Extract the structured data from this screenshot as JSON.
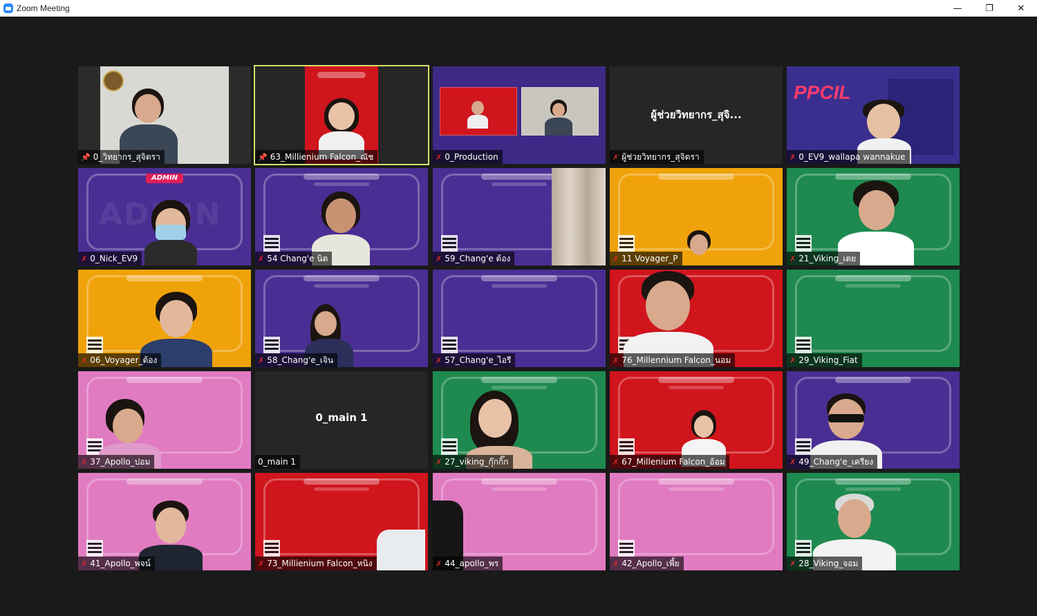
{
  "window": {
    "title": "Zoom Meeting",
    "minimize_glyph": "—",
    "restore_glyph": "❐",
    "close_glyph": "✕"
  },
  "icons": {
    "muted": "✗",
    "pinned": "📌"
  },
  "tiles": [
    {
      "name": "0_วิทยากร_สุจิตรา",
      "status": "pinned",
      "active": false
    },
    {
      "name": "63_Millienium Falcon_ณัช",
      "status": "pinned",
      "active": true
    },
    {
      "name": "0_Production",
      "status": "muted",
      "active": false
    },
    {
      "name": "ผู้ช่วยวิทยากร_สุจิตรา",
      "status": "muted",
      "active": false,
      "center_text": "ผู้ช่วยวิทยากร_สุจิ..."
    },
    {
      "name": "0_EV9_wallapa wannakue",
      "status": "muted",
      "active": false
    },
    {
      "name": "0_Nick_EV9",
      "status": "muted",
      "active": false,
      "badge": "ADMIN"
    },
    {
      "name": "54 Chang'e นิต",
      "status": "muted",
      "active": false
    },
    {
      "name": "59_Chang'e ต้อง",
      "status": "muted",
      "active": false
    },
    {
      "name": "11 Voyager_P",
      "status": "muted",
      "active": false
    },
    {
      "name": "21_Viking_เตย",
      "status": "muted",
      "active": false
    },
    {
      "name": "06_Voyager_ต้อง",
      "status": "muted",
      "active": false
    },
    {
      "name": "58_Chang'e_เจิน",
      "status": "muted",
      "active": false
    },
    {
      "name": "57_Chang'e_ไอรี",
      "status": "muted",
      "active": false
    },
    {
      "name": "76_Millennium Falcon_นอม",
      "status": "muted",
      "active": false
    },
    {
      "name": "29_Viking_Fiat",
      "status": "muted",
      "active": false
    },
    {
      "name": "37_Apollo_ปอม",
      "status": "muted",
      "active": false
    },
    {
      "name": "0_main 1",
      "status": "none",
      "active": false,
      "center_text": "0_main 1"
    },
    {
      "name": "27_viking_กุ๊กกิ๊ก",
      "status": "muted",
      "active": false
    },
    {
      "name": "67_Millenium Falcon_อ้อม",
      "status": "muted",
      "active": false
    },
    {
      "name": "49_Chang'e_เครียง",
      "status": "muted",
      "active": false
    },
    {
      "name": "41_Apollo_พจน์",
      "status": "muted",
      "active": false
    },
    {
      "name": "73_Millienium Falcon_หนิง",
      "status": "muted",
      "active": false
    },
    {
      "name": "44_apollo_พร",
      "status": "muted",
      "active": false
    },
    {
      "name": "42_Apollo_เพี้ย",
      "status": "muted",
      "active": false
    },
    {
      "name": "28_Viking_จอม",
      "status": "muted",
      "active": false
    }
  ],
  "colors": {
    "purple": "#4a2e93",
    "red": "#d0151d",
    "yellow": "#f0a20a",
    "green": "#1e8a4f",
    "pink": "#e07bc1",
    "dark": "#262626",
    "active_border": "#d8e06a"
  }
}
